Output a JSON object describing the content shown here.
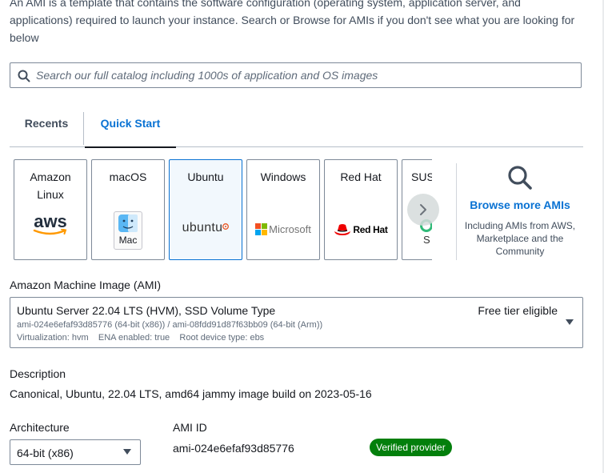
{
  "intro_text": "An AMI is a template that contains the software configuration (operating system, application server, and applications) required to launch your instance. Search or Browse for AMIs if you don't see what you are looking for below",
  "search": {
    "placeholder": "Search our full catalog including 1000s of application and OS images",
    "icon": "search-icon"
  },
  "tabs": [
    {
      "label": "Recents",
      "active": false
    },
    {
      "label": "Quick Start",
      "active": true
    }
  ],
  "os_options": [
    {
      "name": "Amazon Linux",
      "logo_text": "aws",
      "selected": false
    },
    {
      "name": "macOS",
      "logo_text": "Mac",
      "selected": false
    },
    {
      "name": "Ubuntu",
      "logo_text": "ubuntu",
      "selected": true
    },
    {
      "name": "Windows",
      "logo_text": "Microsoft",
      "selected": false
    },
    {
      "name": "Red Hat",
      "logo_text": "Red Hat",
      "selected": false
    },
    {
      "name": "SUS",
      "logo_text": "S",
      "selected": false
    }
  ],
  "browse": {
    "link": "Browse more AMIs",
    "description": "Including AMIs from AWS, Marketplace and the Community"
  },
  "ami": {
    "label": "Amazon Machine Image (AMI)",
    "title": "Ubuntu Server 22.04 LTS (HVM), SSD Volume Type",
    "ids": "ami-024e6efaf93d85776 (64-bit (x86)) / ami-08fdd91d87f63bb09 (64-bit (Arm))",
    "meta": "Virtualization: hvm    ENA enabled: true    Root device type: ebs",
    "tier": "Free tier eligible"
  },
  "description": {
    "label": "Description",
    "value": "Canonical, Ubuntu, 22.04 LTS, amd64 jammy image build on 2023-05-16"
  },
  "architecture": {
    "label": "Architecture",
    "value": "64-bit (x86)"
  },
  "ami_id": {
    "label": "AMI ID",
    "value": "ami-024e6efaf93d85776"
  },
  "badge": {
    "label": "Verified provider",
    "color": "#037f0c"
  },
  "colors": {
    "link": "#0972d3",
    "selected_border": "#0972d3",
    "selected_bg": "#f2f8fd"
  }
}
